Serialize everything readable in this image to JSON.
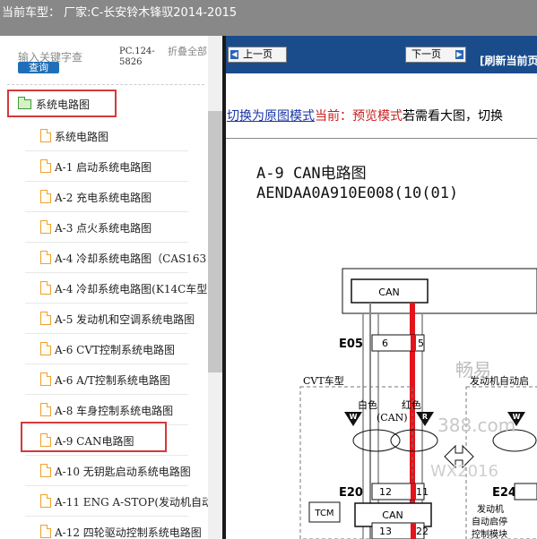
{
  "header": {
    "title": "当前车型： 厂家:C-长安铃木锋驭2014-2015"
  },
  "search": {
    "placeholder": "输入关键字查",
    "button": "查询"
  },
  "pc_code": "PC.124-5826",
  "collapse_label": "折叠全部",
  "tree": {
    "root": "系统电路图",
    "items": [
      "系统电路图",
      "A-1 启动系统电路图",
      "A-2 充电系统电路图",
      "A-3 点火系统电路图",
      "A-4 冷却系统电路图（CAS163",
      "A-4 冷却系统电路图(K14C车型",
      "A-5 发动机和空调系统电路图",
      "A-6 CVT控制系统电路图",
      "A-6 A/T控制系统电路图",
      "A-8 车身控制系统电路图",
      "A-9 CAN电路图",
      "A-10 无钥匙启动系统电路图",
      "A-11 ENG A-STOP(发动机自动",
      "A-12 四轮驱动控制系统电路图"
    ]
  },
  "nav": {
    "prev": "上一页",
    "next": "下一页",
    "refresh": "[刷新当前页"
  },
  "mode": {
    "link": "切换为原图模式",
    "current": "当前：预览模式",
    "rest": "若需看大图，切换"
  },
  "doc": {
    "title": "A-9 CAN电路图",
    "code": "AENDAA0A910E008(10(01)"
  },
  "diagram": {
    "can_top": "CAN",
    "e05": "E05",
    "e05_pin_a": "6",
    "e05_pin_b": "5",
    "cvt_label": "CVT车型",
    "engine_auto_label": "发动机自动启",
    "white": "白色",
    "red": "红色",
    "can_mid": "(CAN)",
    "w": "W",
    "r": "R",
    "e20": "E20",
    "e20_pin_a": "12",
    "e20_pin_b": "11",
    "e24": "E24",
    "tcm": "TCM",
    "can_lower": "CAN",
    "module_label_1": "发动机",
    "module_label_2": "自动启停",
    "module_label_3": "控制模块",
    "pin_bottom_a": "13",
    "pin_bottom_b": "22",
    "watermark_1": "畅易",
    "watermark_2": "388.com",
    "watermark_3": "WX2016"
  },
  "colors": {
    "header_bg": "#888888",
    "nav_bg": "#1a4c8c",
    "highlight": "#d33a3a",
    "can_red": "#e3141b"
  }
}
